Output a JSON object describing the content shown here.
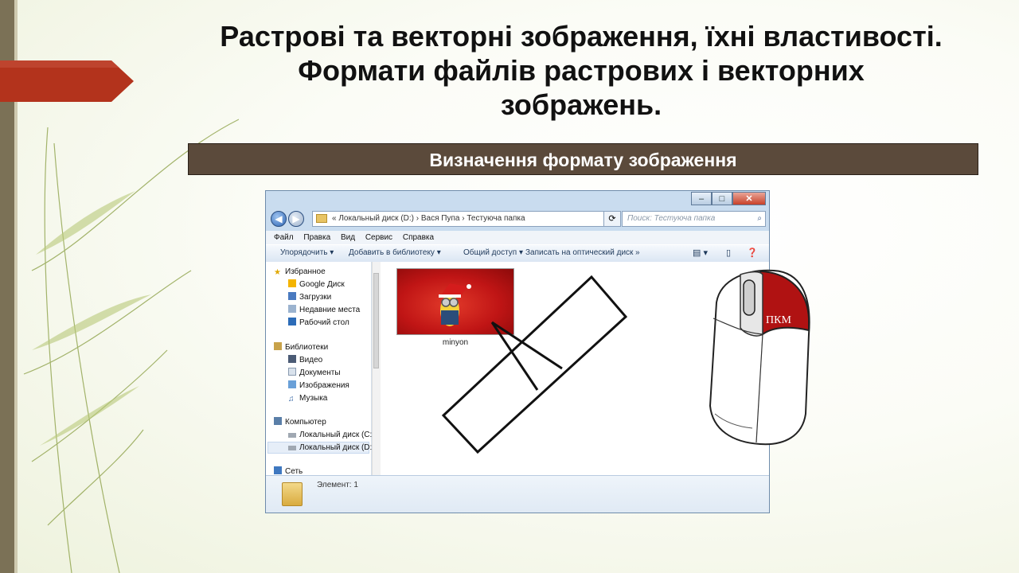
{
  "slide": {
    "title": "Растрові та векторні зображення, їхні властивості. Формати файлів растрових і векторних зображень.",
    "subtitle": "Визначення формату зображення"
  },
  "explorer": {
    "address": "«  Локальный диск (D:)  ›  Вася Пупа  ›  Тестуюча папка",
    "search_placeholder": "Поиск: Тестуюча папка",
    "menu": [
      "Файл",
      "Правка",
      "Вид",
      "Сервис",
      "Справка"
    ],
    "toolbar": {
      "organize": "Упорядочить ▾",
      "add_to_library": "Добавить в библиотеку ▾",
      "share": "Общий доступ ▾",
      "burn": "Записать на оптический диск",
      "more": "»"
    },
    "nav": {
      "favorites": "Избранное",
      "favorites_items": [
        "Google Диск",
        "Загрузки",
        "Недавние места",
        "Рабочий стол"
      ],
      "libraries": "Библиотеки",
      "libraries_items": [
        "Видео",
        "Документы",
        "Изображения",
        "Музыка"
      ],
      "computer": "Компьютер",
      "computer_items": [
        "Локальный диск (C:)",
        "Локальный диск (D:)"
      ],
      "network": "Сеть"
    },
    "file": {
      "name": "minyon"
    },
    "status": "Элемент: 1"
  },
  "mouse": {
    "label": "ПКМ"
  },
  "colors": {
    "title_bar": "#5b4a3b",
    "ribbon": "#b3331c",
    "mouse_button": "#b01212"
  }
}
